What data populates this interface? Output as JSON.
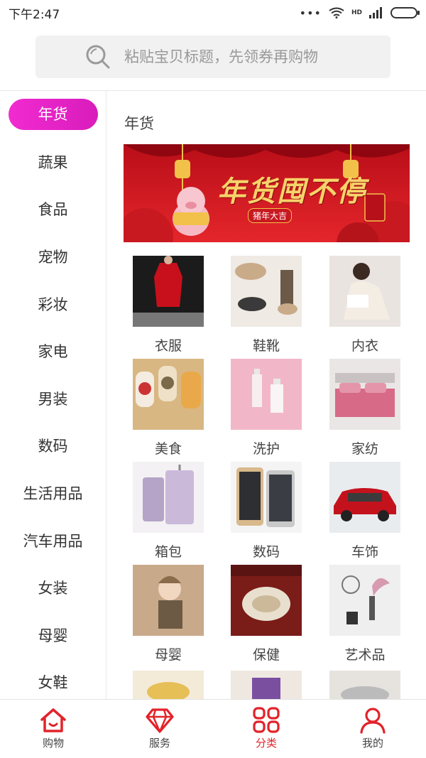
{
  "status": {
    "time": "下午2:47",
    "network": "HD"
  },
  "search": {
    "placeholder": "粘贴宝贝标题，先领券再购物"
  },
  "sidebar": {
    "items": [
      {
        "label": "年货"
      },
      {
        "label": "蔬果"
      },
      {
        "label": "食品"
      },
      {
        "label": "宠物"
      },
      {
        "label": "彩妆"
      },
      {
        "label": "家电"
      },
      {
        "label": "男装"
      },
      {
        "label": "数码"
      },
      {
        "label": "生活用品"
      },
      {
        "label": "汽车用品"
      },
      {
        "label": "女装"
      },
      {
        "label": "母婴"
      },
      {
        "label": "女鞋"
      }
    ]
  },
  "main": {
    "section_title": "年货",
    "banner": {
      "headline": "年货囤不停",
      "badge": "猪年大吉"
    },
    "categories": [
      {
        "label": "衣服"
      },
      {
        "label": "鞋靴"
      },
      {
        "label": "内衣"
      },
      {
        "label": "美食"
      },
      {
        "label": "洗护"
      },
      {
        "label": "家纺"
      },
      {
        "label": "箱包"
      },
      {
        "label": "数码"
      },
      {
        "label": "车饰"
      },
      {
        "label": "母婴"
      },
      {
        "label": "保健"
      },
      {
        "label": "艺术品"
      }
    ]
  },
  "tabbar": {
    "tabs": [
      {
        "label": "购物",
        "icon": "home-icon"
      },
      {
        "label": "服务",
        "icon": "diamond-icon"
      },
      {
        "label": "分类",
        "icon": "grid-icon"
      },
      {
        "label": "我的",
        "icon": "user-icon"
      }
    ]
  },
  "colors": {
    "accent": "#e2232a",
    "active_pill": "#e827c9",
    "banner_red": "#d71920"
  }
}
